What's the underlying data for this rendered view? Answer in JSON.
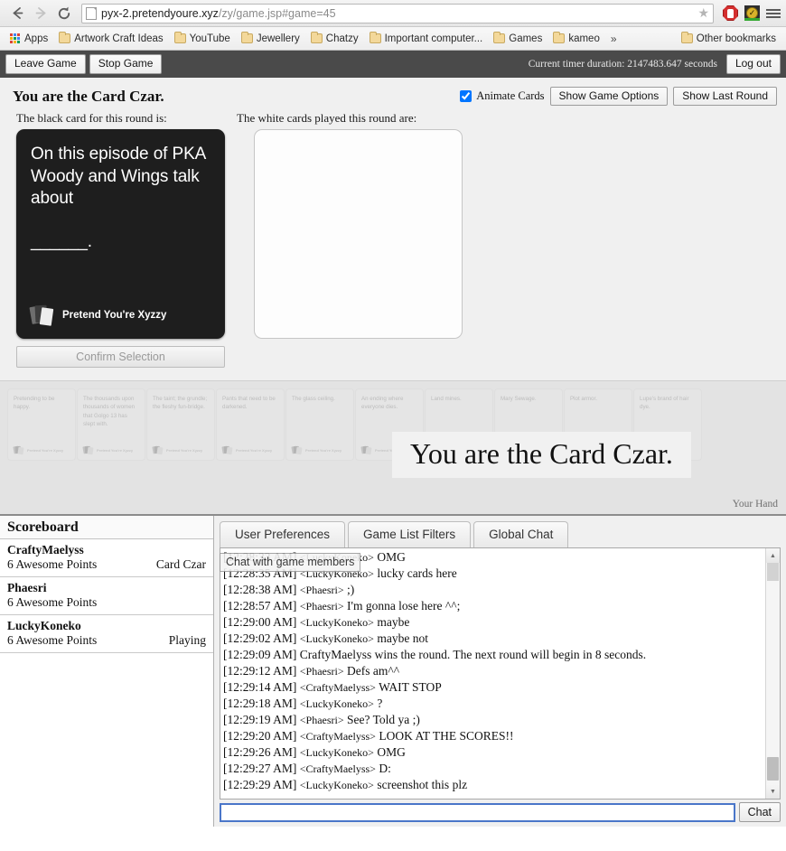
{
  "browser": {
    "back_icon": "back-arrow-icon",
    "forward_icon": "forward-arrow-icon",
    "reload_icon": "reload-icon",
    "url_main": "pyx-2.pretendyoure.xyz",
    "url_path": "/zy/game.jsp#game=45",
    "star_glyph": "★",
    "extensions": [
      {
        "name": "adblock-icon",
        "label": "AdBlock"
      },
      {
        "name": "security-check-icon",
        "label": "Web of Trust",
        "check": "✓"
      }
    ],
    "menu_icon": "hamburger-menu-icon",
    "bookmarks": [
      {
        "label": "Apps",
        "icon": "apps-grid-icon"
      },
      {
        "label": "Artwork Craft Ideas",
        "icon": "folder-icon"
      },
      {
        "label": "YouTube",
        "icon": "folder-icon"
      },
      {
        "label": "Jewellery",
        "icon": "folder-icon"
      },
      {
        "label": "Chatzy",
        "icon": "folder-icon"
      },
      {
        "label": "Important computer...",
        "icon": "folder-icon"
      },
      {
        "label": "Games",
        "icon": "folder-icon"
      },
      {
        "label": "kameo",
        "icon": "folder-icon"
      }
    ],
    "bookmarks_overflow": "»",
    "other_bookmarks": {
      "label": "Other bookmarks",
      "icon": "folder-icon"
    }
  },
  "game_topbar": {
    "leave_game": "Leave Game",
    "stop_game": "Stop Game",
    "timer_text": "Current timer duration: 2147483.647 seconds",
    "logout": "Log out"
  },
  "game": {
    "status_title": "You are the Card Czar.",
    "animate_cards_label": "Animate Cards",
    "animate_cards_checked": true,
    "show_game_options": "Show Game Options",
    "show_last_round": "Show Last Round",
    "black_card_label": "The black card for this round is:",
    "white_cards_label": "The white cards played this round are:",
    "black_card": {
      "text": "On this episode of PKA Woody and Wings talk about",
      "blank": "______.",
      "brand": "Pretend You're Xyzzy"
    },
    "confirm_selection": "Confirm Selection",
    "confirm_disabled": true,
    "czar_overlay": "You are the Card Czar.",
    "your_hand_label": "Your Hand",
    "hand": [
      {
        "text": "Pretending to be happy.",
        "brand": "Pretend You're Xyzzy"
      },
      {
        "text": "The thousands upon thousands of women that Golgo 13 has slept with.",
        "brand": "Pretend You're Xyzzy"
      },
      {
        "text": "The taint; the grundle; the fleshy fun-bridge.",
        "brand": "Pretend You're Xyzzy"
      },
      {
        "text": "Pants that need to be darkened.",
        "brand": "Pretend You're Xyzzy"
      },
      {
        "text": "The glass ceiling.",
        "brand": "Pretend You're Xyzzy"
      },
      {
        "text": "An ending where everyone dies.",
        "brand": "Pretend You're Xyzzy"
      },
      {
        "text": "Land mines.",
        "brand": "Pretend You're Xyzzy"
      },
      {
        "text": "Mary Sewage.",
        "brand": "Pretend You're Xyzzy"
      },
      {
        "text": "Plot armor.",
        "brand": "Pretend You're Xyzzy"
      },
      {
        "text": "Lupe's brand of hair dye.",
        "brand": "Pretend You're Xyzzy"
      }
    ]
  },
  "scoreboard": {
    "title": "Scoreboard",
    "players": [
      {
        "name": "CraftyMaelyss",
        "points": "6 Awesome Points",
        "status": "Card Czar"
      },
      {
        "name": "Phaesri",
        "points": "6 Awesome Points",
        "status": ""
      },
      {
        "name": "LuckyKoneko",
        "points": "6 Awesome Points",
        "status": "Playing"
      }
    ]
  },
  "chat": {
    "tabs": [
      {
        "label": "User Preferences"
      },
      {
        "label": "Game List Filters"
      },
      {
        "label": "Global Chat"
      }
    ],
    "tooltip": "Chat with game members",
    "input_value": "",
    "input_placeholder": "",
    "send_label": "Chat",
    "messages": [
      {
        "time": "[12:28:33 AM]",
        "nick": "<LuckyKoneko>",
        "text": "OMG"
      },
      {
        "time": "[12:28:35 AM]",
        "nick": "<LuckyKoneko>",
        "text": "lucky cards here"
      },
      {
        "time": "[12:28:38 AM]",
        "nick": "<Phaesri>",
        "text": ";)"
      },
      {
        "time": "[12:28:57 AM]",
        "nick": "<Phaesri>",
        "text": "I'm gonna lose here ^^;"
      },
      {
        "time": "[12:29:00 AM]",
        "nick": "<LuckyKoneko>",
        "text": "maybe"
      },
      {
        "time": "[12:29:02 AM]",
        "nick": "<LuckyKoneko>",
        "text": "maybe not"
      },
      {
        "time": "[12:29:09 AM]",
        "nick": "",
        "text": "CraftyMaelyss wins the round. The next round will begin in 8 seconds."
      },
      {
        "time": "[12:29:12 AM]",
        "nick": "<Phaesri>",
        "text": "Defs am^^"
      },
      {
        "time": "[12:29:14 AM]",
        "nick": "<CraftyMaelyss>",
        "text": "WAIT STOP"
      },
      {
        "time": "[12:29:18 AM]",
        "nick": "<LuckyKoneko>",
        "text": "?"
      },
      {
        "time": "[12:29:19 AM]",
        "nick": "<Phaesri>",
        "text": "See? Told ya ;)"
      },
      {
        "time": "[12:29:20 AM]",
        "nick": "<CraftyMaelyss>",
        "text": "LOOK AT THE SCORES!!"
      },
      {
        "time": "[12:29:26 AM]",
        "nick": "<LuckyKoneko>",
        "text": "OMG"
      },
      {
        "time": "[12:29:27 AM]",
        "nick": "<CraftyMaelyss>",
        "text": "D:"
      },
      {
        "time": "[12:29:29 AM]",
        "nick": "<LuckyKoneko>",
        "text": "screenshot this plz"
      }
    ]
  },
  "colors": {
    "topbar_bg": "#4a4a4a",
    "black_card_bg": "#1e1e1e",
    "accent_input_border": "#4a76c9",
    "game_bg": "#f0f0f0"
  }
}
